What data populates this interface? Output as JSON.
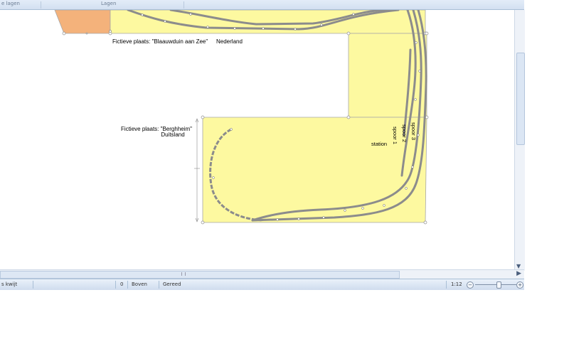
{
  "ribbon": {
    "group_left_label": "e lagen",
    "group_right_label": "Lagen"
  },
  "canvas": {
    "colors": {
      "baseboard": "#fdf9a0",
      "baseboard_edge": "#a8a8a8",
      "track": "#8c8c8c",
      "orange_board": "#f4b27b"
    },
    "labels": {
      "place_north": "Fictieve plaats: \"Blaauwduin aan Zee\"",
      "country_north": "Nederland",
      "place_south": "Fictieve plaats: \"Berghheim\"",
      "country_south": "Duitsland",
      "track_1": "spoor 1",
      "track_2": "spoor 2",
      "track_3": "spoor 3",
      "station": "station"
    }
  },
  "statusbar": {
    "left_text": "s kwijt",
    "count": "0",
    "layer": "Boven",
    "state": "Gereed",
    "scale": "1:12",
    "zoom_out": "−",
    "zoom_in": "+"
  },
  "icons": {
    "scroll_down": "chevron-down-icon",
    "scroll_right": "chevron-right-icon"
  }
}
